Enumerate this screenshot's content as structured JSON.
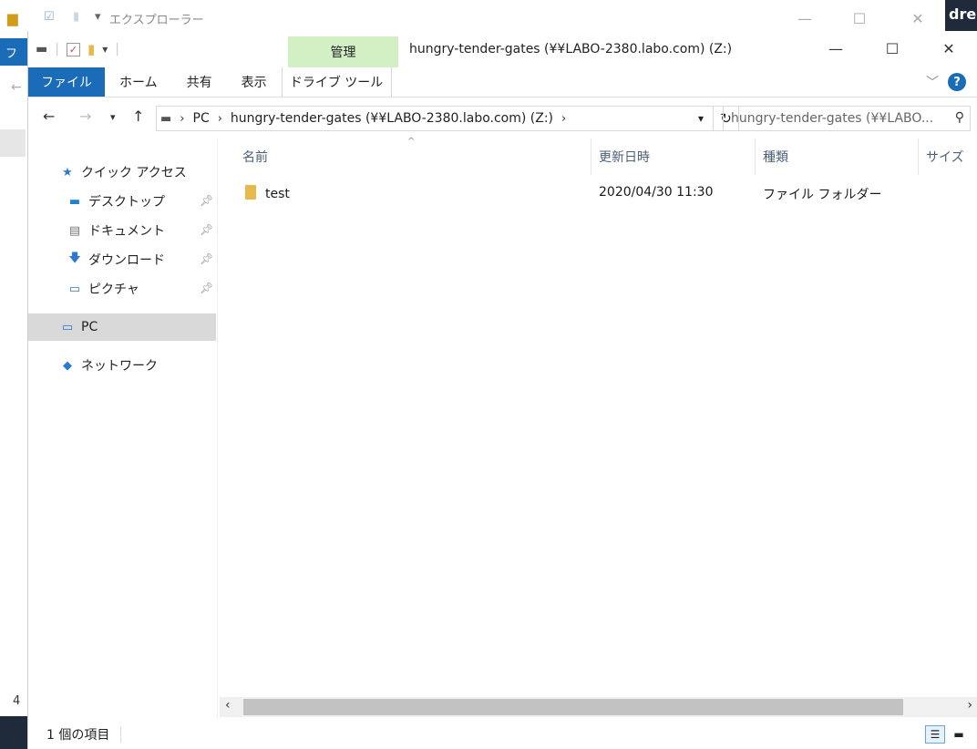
{
  "background_window": {
    "title": "エクスプローラー",
    "tab_file": "ファ",
    "corner_text": "dres",
    "side_number": "4"
  },
  "window": {
    "title": "hungry-tender-gates (¥¥LABO-2380.labo.com) (Z:)",
    "tool_group": "管理",
    "controls": {
      "minimize": "—",
      "maximize": "☐",
      "close": "✕"
    }
  },
  "ribbon": {
    "tabs": [
      "ファイル",
      "ホーム",
      "共有",
      "表示",
      "ドライブ ツール"
    ]
  },
  "address": {
    "crumbs": [
      "PC",
      "hungry-tender-gates (¥¥LABO-2380.labo.com) (Z:)"
    ],
    "search_placeholder": "hungry-tender-gates (¥¥LABO..."
  },
  "nav_pane": {
    "quick_access": "クイック アクセス",
    "pinned": [
      "デスクトップ",
      "ドキュメント",
      "ダウンロード",
      "ピクチャ"
    ],
    "pc": "PC",
    "network": "ネットワーク"
  },
  "columns": {
    "name": "名前",
    "modified": "更新日時",
    "type": "種類",
    "size": "サイズ"
  },
  "files": [
    {
      "name": "test",
      "modified": "2020/04/30 11:30",
      "type": "ファイル フォルダー"
    }
  ],
  "status": {
    "item_count": "1 個の項目"
  },
  "colors": {
    "accent": "#1a6bb8",
    "tool_header": "#d3f0c5",
    "selection": "#d9d9d9",
    "folder": "#e8b94a"
  }
}
